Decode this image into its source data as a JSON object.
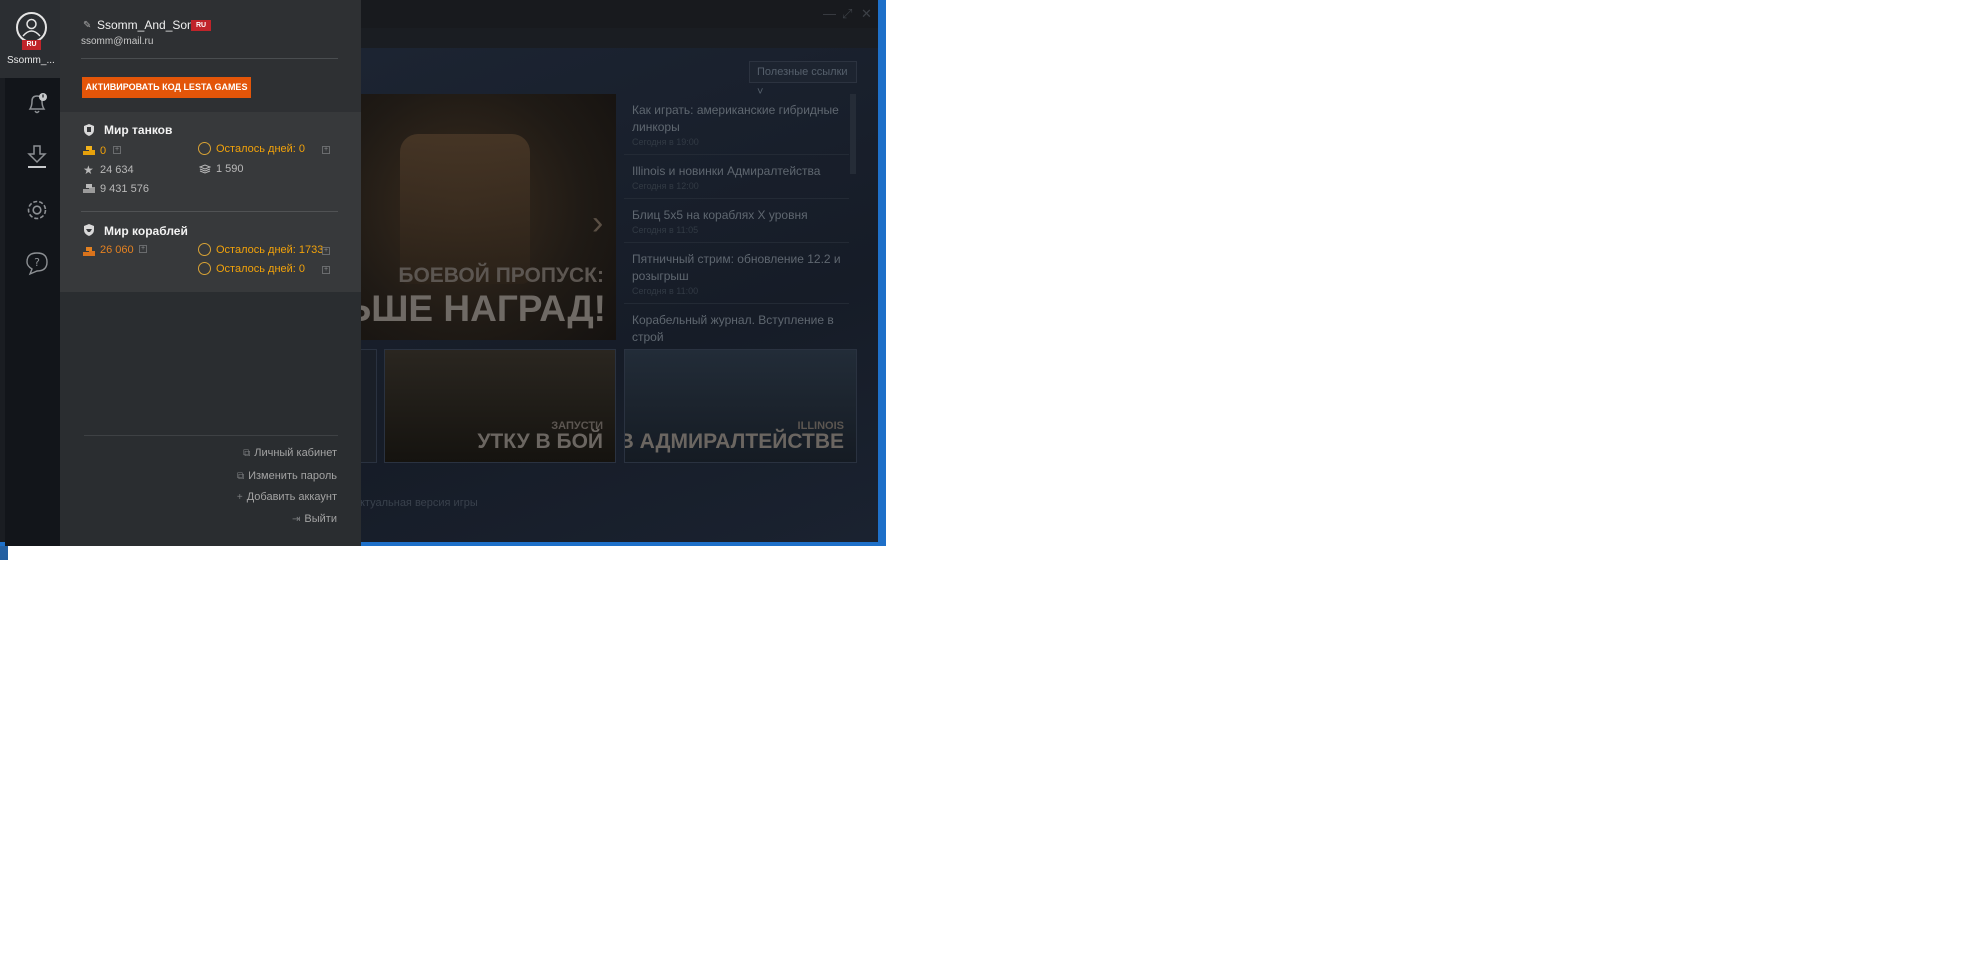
{
  "profile": {
    "avatar_badge": "RU",
    "avatar_name": "Ssomm_...",
    "username": "Ssomm_And_Son",
    "region": "RU",
    "email": "ssomm@mail.ru",
    "activate_button": "АКТИВИРОВАТЬ КОД LESTA GAMES"
  },
  "games": {
    "tanks": {
      "title": "Мир танков",
      "gold": "0",
      "premium": "Осталось дней: 0",
      "rating": "24 634",
      "free_xp": "1 590",
      "credits": "9 431 576"
    },
    "ships": {
      "title": "Мир кораблей",
      "doubloons": "26 060",
      "premium": "Осталось дней: 1733",
      "premium2": "Осталось дней: 0"
    }
  },
  "links": {
    "cabinet": "Личный кабинет",
    "change_password": "Изменить пароль",
    "add_account": "Добавить аккаунт",
    "logout": "Выйти"
  },
  "launcher": {
    "useful_links": "Полезные ссылки",
    "banner_subtitle": "БОЕВОЙ ПРОПУСК:",
    "banner_title": "ОЛЬШЕ НАГРАД!",
    "news": [
      {
        "title": "Как играть: американские гибридные линкоры",
        "time": "Сегодня в 19:00"
      },
      {
        "title": "Illinois и новинки Адмиралтейства",
        "time": "Сегодня в 12:00"
      },
      {
        "title": "Блиц 5х5 на кораблях X уровня",
        "time": "Сегодня в 11:05"
      },
      {
        "title": "Пятничный стрим: обновление 12.2 и розыгрыш",
        "time": "Сегодня в 11:00"
      },
      {
        "title": "Корабельный журнал. Вступление в строй",
        "time": ""
      }
    ],
    "tile2_sub": "ЗАПУСТИ",
    "tile2_title": "УТКУ В БОЙ",
    "tile3_sub": "ILLINOIS",
    "tile3_title": "В АДМИРАЛТЕЙСТВЕ",
    "version": "ктуальная версия игры"
  },
  "icons": [
    "user-icon",
    "notification-bell-icon",
    "download-icon",
    "settings-gear-icon",
    "support-question-icon",
    "pencil-icon",
    "tank-emblem-icon",
    "ship-emblem-icon",
    "gold-coins-icon",
    "premium-emblem-icon",
    "rating-star-icon",
    "free-xp-icon",
    "credits-icon",
    "external-link-icon",
    "plus-icon",
    "logout-icon"
  ],
  "colors": {
    "accent_orange": "#e35509",
    "gold_text": "#f2a20a",
    "region_red": "#c0242a",
    "desktop_border_blue": "#1e70c9"
  }
}
